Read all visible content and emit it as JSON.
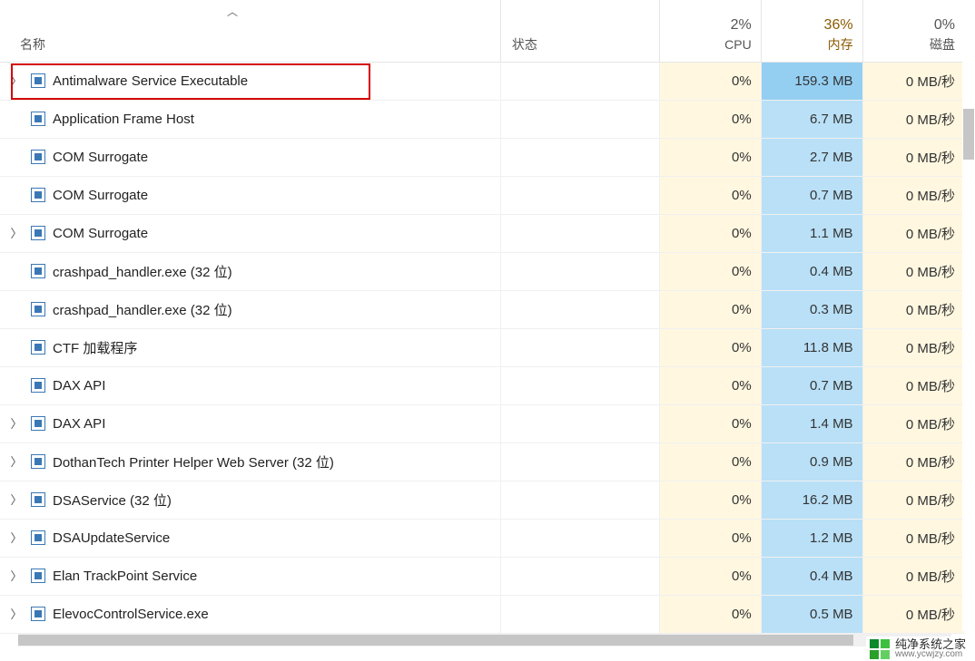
{
  "header": {
    "name": "名称",
    "status": "状态",
    "cpu_pct": "2%",
    "cpu_label": "CPU",
    "mem_pct": "36%",
    "mem_label": "内存",
    "disk_pct": "0%",
    "disk_label": "磁盘"
  },
  "rows": [
    {
      "name": "Antimalware Service Executable",
      "expandable": true,
      "cpu": "0%",
      "mem": "159.3 MB",
      "mem_high": true,
      "disk": "0 MB/秒"
    },
    {
      "name": "Application Frame Host",
      "expandable": false,
      "cpu": "0%",
      "mem": "6.7 MB",
      "mem_high": false,
      "disk": "0 MB/秒"
    },
    {
      "name": "COM Surrogate",
      "expandable": false,
      "cpu": "0%",
      "mem": "2.7 MB",
      "mem_high": false,
      "disk": "0 MB/秒"
    },
    {
      "name": "COM Surrogate",
      "expandable": false,
      "cpu": "0%",
      "mem": "0.7 MB",
      "mem_high": false,
      "disk": "0 MB/秒"
    },
    {
      "name": "COM Surrogate",
      "expandable": true,
      "cpu": "0%",
      "mem": "1.1 MB",
      "mem_high": false,
      "disk": "0 MB/秒"
    },
    {
      "name": "crashpad_handler.exe (32 位)",
      "expandable": false,
      "cpu": "0%",
      "mem": "0.4 MB",
      "mem_high": false,
      "disk": "0 MB/秒"
    },
    {
      "name": "crashpad_handler.exe (32 位)",
      "expandable": false,
      "cpu": "0%",
      "mem": "0.3 MB",
      "mem_high": false,
      "disk": "0 MB/秒"
    },
    {
      "name": "CTF 加载程序",
      "expandable": false,
      "cpu": "0%",
      "mem": "11.8 MB",
      "mem_high": false,
      "disk": "0 MB/秒"
    },
    {
      "name": "DAX API",
      "expandable": false,
      "cpu": "0%",
      "mem": "0.7 MB",
      "mem_high": false,
      "disk": "0 MB/秒"
    },
    {
      "name": "DAX API",
      "expandable": true,
      "cpu": "0%",
      "mem": "1.4 MB",
      "mem_high": false,
      "disk": "0 MB/秒"
    },
    {
      "name": "DothanTech Printer Helper Web Server (32 位)",
      "expandable": true,
      "cpu": "0%",
      "mem": "0.9 MB",
      "mem_high": false,
      "disk": "0 MB/秒"
    },
    {
      "name": "DSAService (32 位)",
      "expandable": true,
      "cpu": "0%",
      "mem": "16.2 MB",
      "mem_high": false,
      "disk": "0 MB/秒"
    },
    {
      "name": "DSAUpdateService",
      "expandable": true,
      "cpu": "0%",
      "mem": "1.2 MB",
      "mem_high": false,
      "disk": "0 MB/秒"
    },
    {
      "name": "Elan TrackPoint Service",
      "expandable": true,
      "cpu": "0%",
      "mem": "0.4 MB",
      "mem_high": false,
      "disk": "0 MB/秒"
    },
    {
      "name": "ElevocControlService.exe",
      "expandable": true,
      "cpu": "0%",
      "mem": "0.5 MB",
      "mem_high": false,
      "disk": "0 MB/秒"
    }
  ],
  "watermark": {
    "title": "纯净系统之家",
    "url": "www.ycwjzy.com"
  }
}
